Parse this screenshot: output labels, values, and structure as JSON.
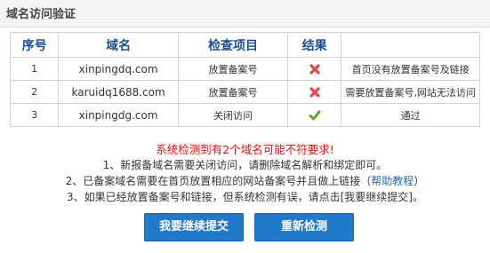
{
  "dialog": {
    "title": "域名访问验证"
  },
  "table": {
    "headers": [
      "序号",
      "域名",
      "检查项目",
      "结果",
      ""
    ],
    "rows": [
      {
        "index": "1",
        "domain": "xinpingdq.com",
        "item": "放置备案号",
        "result": "fail",
        "note": "首页没有放置备案号及链接"
      },
      {
        "index": "2",
        "domain": "karuidq1688.com",
        "item": "放置备案号",
        "result": "fail",
        "note": "需要放置备案号,网站无法访问"
      },
      {
        "index": "3",
        "domain": "xinpingdg.com",
        "item": "关闭访问",
        "result": "pass",
        "note": "通过"
      }
    ]
  },
  "colors": {
    "fail": "#e04a4a",
    "pass": "#5aa82a",
    "button": "#1f7ac9"
  },
  "messages": {
    "warning": "系统检测到有2个域名可能不符要求!",
    "line1": "1、新报备域名需要关闭访问，请删除域名解析和绑定即可。",
    "line2_pre": "2、已备案域名需要在首页放置相应的网站备案号并且做上链接（",
    "line2_link": "帮助教程",
    "line2_post": "）",
    "line3": "3、如果已经放置备案号和链接，但系统检测有误，请点击[我要继续提交]。"
  },
  "buttons": {
    "continue": "我要继续提交",
    "recheck": "重新检测"
  }
}
